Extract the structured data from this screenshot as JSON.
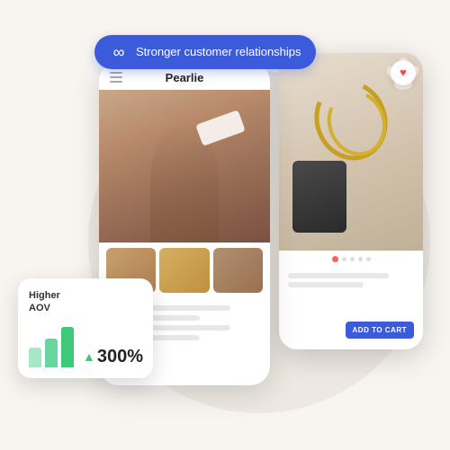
{
  "badge": {
    "icon": "∞",
    "text": "Stronger customer relationships"
  },
  "phone_main": {
    "title": "Pearlie",
    "thumbs": [
      "thumb1",
      "thumb2",
      "thumb3"
    ]
  },
  "phone_right": {
    "heart": "♥",
    "dots": [
      true,
      false,
      false,
      false,
      false
    ],
    "add_to_cart": "ADD TO CART"
  },
  "aov_card": {
    "title_line1": "Higher",
    "title_line2": "AOV",
    "arrow": "▲",
    "percent": "300%"
  }
}
